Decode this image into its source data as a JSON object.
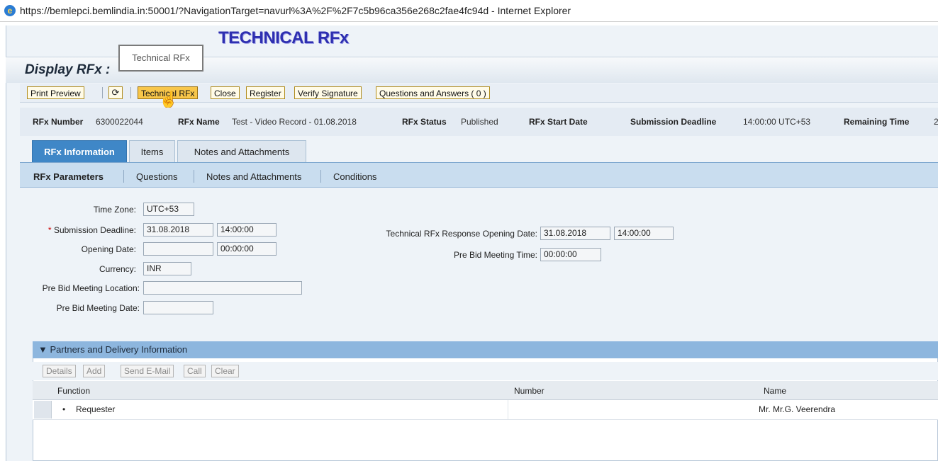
{
  "browser": {
    "title": "https://bemlepci.bemlindia.in:50001/?NavigationTarget=navurl%3A%2F%2F7c5b96ca356e268c2fae4fc94d - Internet Explorer"
  },
  "overlay": {
    "title": "TECHNICAL RFx"
  },
  "header": {
    "title": "Display RFx :"
  },
  "tooltip": {
    "text": "Technical RFx"
  },
  "toolbar": {
    "print_preview": "Print Preview",
    "technical_rfx": "Technical RFx",
    "close": "Close",
    "register": "Register",
    "verify_signature": "Verify Signature",
    "questions_answers": "Questions and Answers ( 0 )"
  },
  "info": {
    "rfx_number_label": "RFx Number",
    "rfx_number": "6300022044",
    "rfx_name_label": "RFx Name",
    "rfx_name": "Test - Video Record - 01.08.2018",
    "rfx_status_label": "RFx Status",
    "rfx_status": "Published",
    "rfx_start_date_label": "RFx Start Date",
    "submission_deadline_label": "Submission Deadline",
    "submission_deadline": "14:00:00 UTC+53",
    "remaining_time_label": "Remaining Time",
    "remaining_time": "2"
  },
  "tabs": [
    "RFx Information",
    "Items",
    "Notes and Attachments"
  ],
  "subtabs": [
    "RFx Parameters",
    "Questions",
    "Notes and Attachments",
    "Conditions"
  ],
  "form": {
    "time_zone_label": "Time Zone:",
    "time_zone": "UTC+53",
    "submission_deadline_label": "Submission Deadline:",
    "submission_date": "31.08.2018",
    "submission_time": "14:00:00",
    "opening_date_label": "Opening Date:",
    "opening_date": "",
    "opening_time": "00:00:00",
    "currency_label": "Currency:",
    "currency": "INR",
    "pre_bid_location_label": "Pre Bid Meeting Location:",
    "pre_bid_location": "",
    "pre_bid_date_label": "Pre Bid Meeting Date:",
    "pre_bid_date": "",
    "tech_opening_label": "Technical RFx Response Opening Date:",
    "tech_opening_date": "31.08.2018",
    "tech_opening_time": "14:00:00",
    "pre_bid_time_label": "Pre Bid Meeting Time:",
    "pre_bid_time": "00:00:00"
  },
  "partners": {
    "title": "Partners and Delivery Information",
    "buttons": [
      "Details",
      "Add",
      "Send E-Mail",
      "Call",
      "Clear"
    ],
    "columns": [
      "Function",
      "Number",
      "Name"
    ],
    "rows": [
      {
        "function": "Requester",
        "number": "",
        "name": "Mr. Mr.G. Veerendra"
      }
    ]
  }
}
